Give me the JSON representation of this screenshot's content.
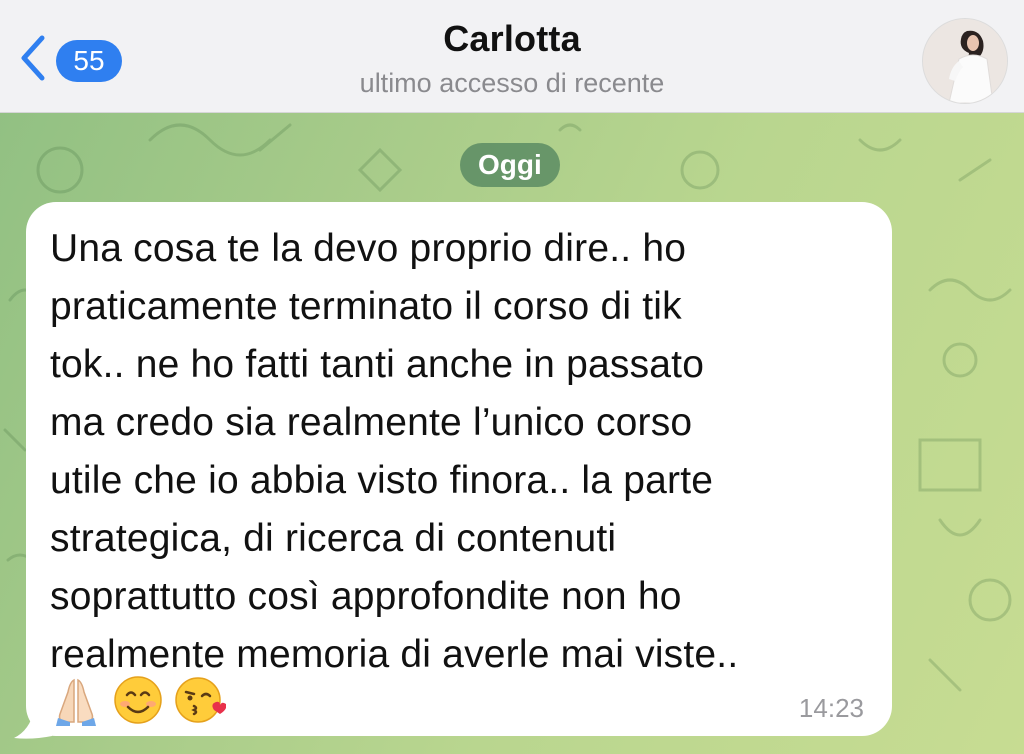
{
  "header": {
    "back_icon": "chevron-left-icon",
    "unread_count": "55",
    "contact_name": "Carlotta",
    "contact_status": "ultimo accesso di recente",
    "avatar_icon": "contact-avatar"
  },
  "chat": {
    "date_label": "Oggi",
    "message": {
      "text": "Una cosa te la devo proprio dire.. ho\npraticamente terminato il corso di tik\ntok.. ne ho fatti tanti anche in passato\nma credo sia realmente l’unico corso\nutile che io abbia visto finora.. la parte\nstrategica, di ricerca di contenuti\nsoprattutto così approfondite non ho\nrealmente memoria di averle mai viste..",
      "emojis": [
        "folded-hands-emoji",
        "smiling-face-emoji",
        "kissing-face-emoji"
      ],
      "time": "14:23"
    }
  },
  "colors": {
    "accent": "#2f7ff0",
    "header_bg": "#f2f2f4",
    "bubble_bg": "#ffffff",
    "date_chip_bg": "#4c805c"
  }
}
